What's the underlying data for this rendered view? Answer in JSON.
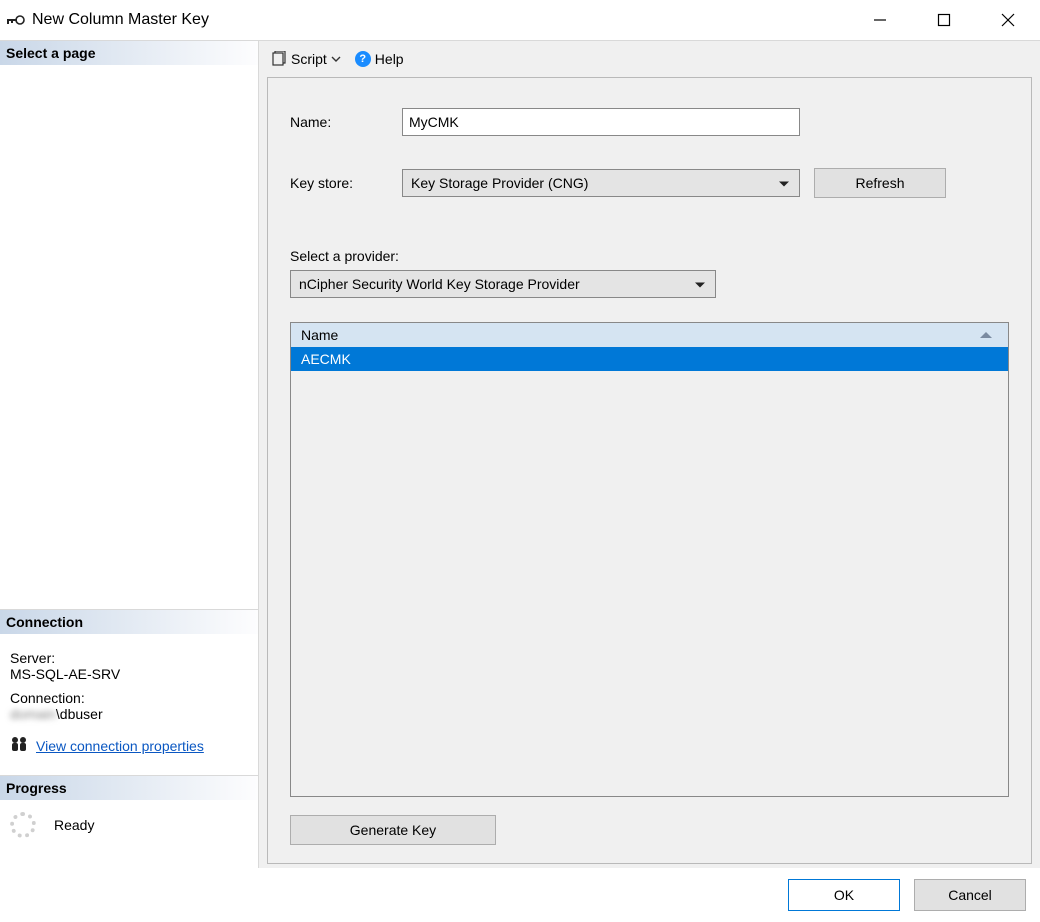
{
  "window": {
    "title": "New Column Master Key"
  },
  "sidebar": {
    "select_page_header": "Select a page",
    "connection_header": "Connection",
    "server_label": "Server:",
    "server_value": "MS-SQL-AE-SRV",
    "connection_label": "Connection:",
    "connection_value_masked": "██████\\dbuser",
    "view_props_link": "View connection properties",
    "progress_header": "Progress",
    "progress_status": "Ready"
  },
  "toolbar": {
    "script_label": "Script",
    "help_label": "Help"
  },
  "form": {
    "name_label": "Name:",
    "name_value": "MyCMK",
    "keystore_label": "Key store:",
    "keystore_value": "Key Storage Provider (CNG)",
    "refresh_label": "Refresh",
    "provider_label": "Select a provider:",
    "provider_value": "nCipher Security World Key Storage Provider",
    "list_header": "Name",
    "list_item_0": "AECMK",
    "generate_key_label": "Generate Key"
  },
  "footer": {
    "ok_label": "OK",
    "cancel_label": "Cancel"
  }
}
